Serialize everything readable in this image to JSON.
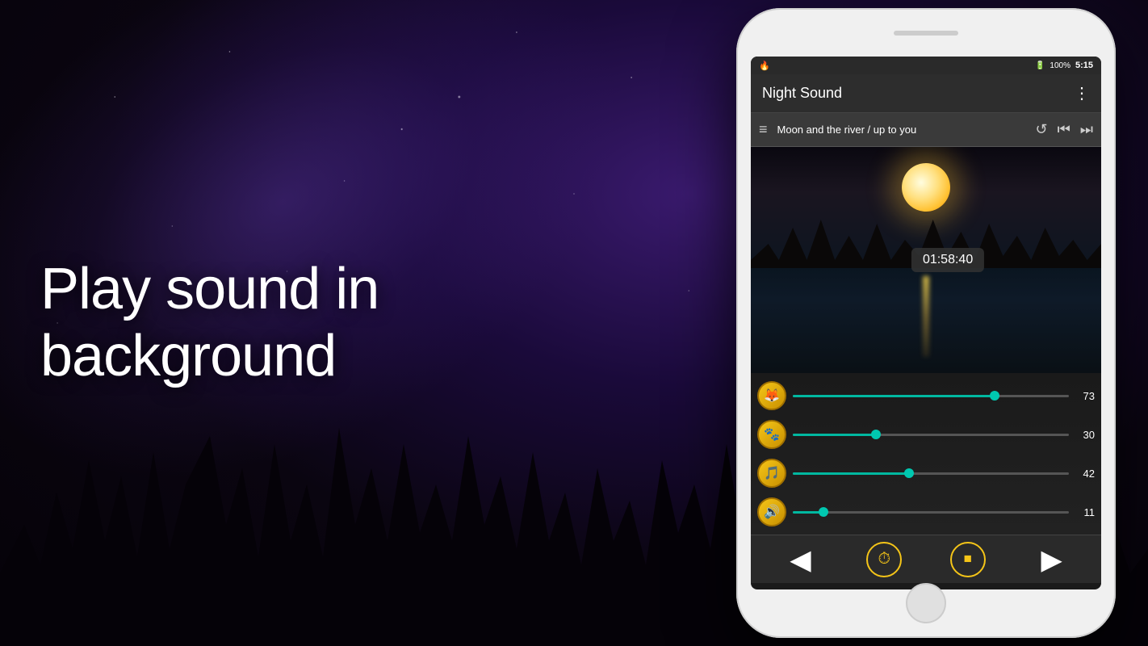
{
  "app": {
    "title": "Night Sound",
    "bg_text_line1": "Play sound in",
    "bg_text_line2": "background",
    "status_bar": {
      "battery": "100%",
      "time": "5:15"
    },
    "toolbar": {
      "track_name": "Moon and the river / up to you",
      "menu_icon": "⋮",
      "hamburger_icon": "≡",
      "repeat_icon": "↺",
      "prev_icon": "⏮",
      "next_icon": "⏭"
    },
    "timer": {
      "value": "01:58:40"
    },
    "sliders": [
      {
        "id": "nature",
        "icon": "🦊",
        "value": 73,
        "percent": 73
      },
      {
        "id": "animal",
        "icon": "🐾",
        "value": 30,
        "percent": 30
      },
      {
        "id": "music",
        "icon": "🎵",
        "value": 42,
        "percent": 42
      },
      {
        "id": "sound",
        "icon": "🔊",
        "value": 11,
        "percent": 11
      }
    ],
    "bottom_nav": {
      "back_label": "◀",
      "timer_label": "⏱",
      "stop_label": "⏹",
      "forward_label": "▶"
    }
  }
}
